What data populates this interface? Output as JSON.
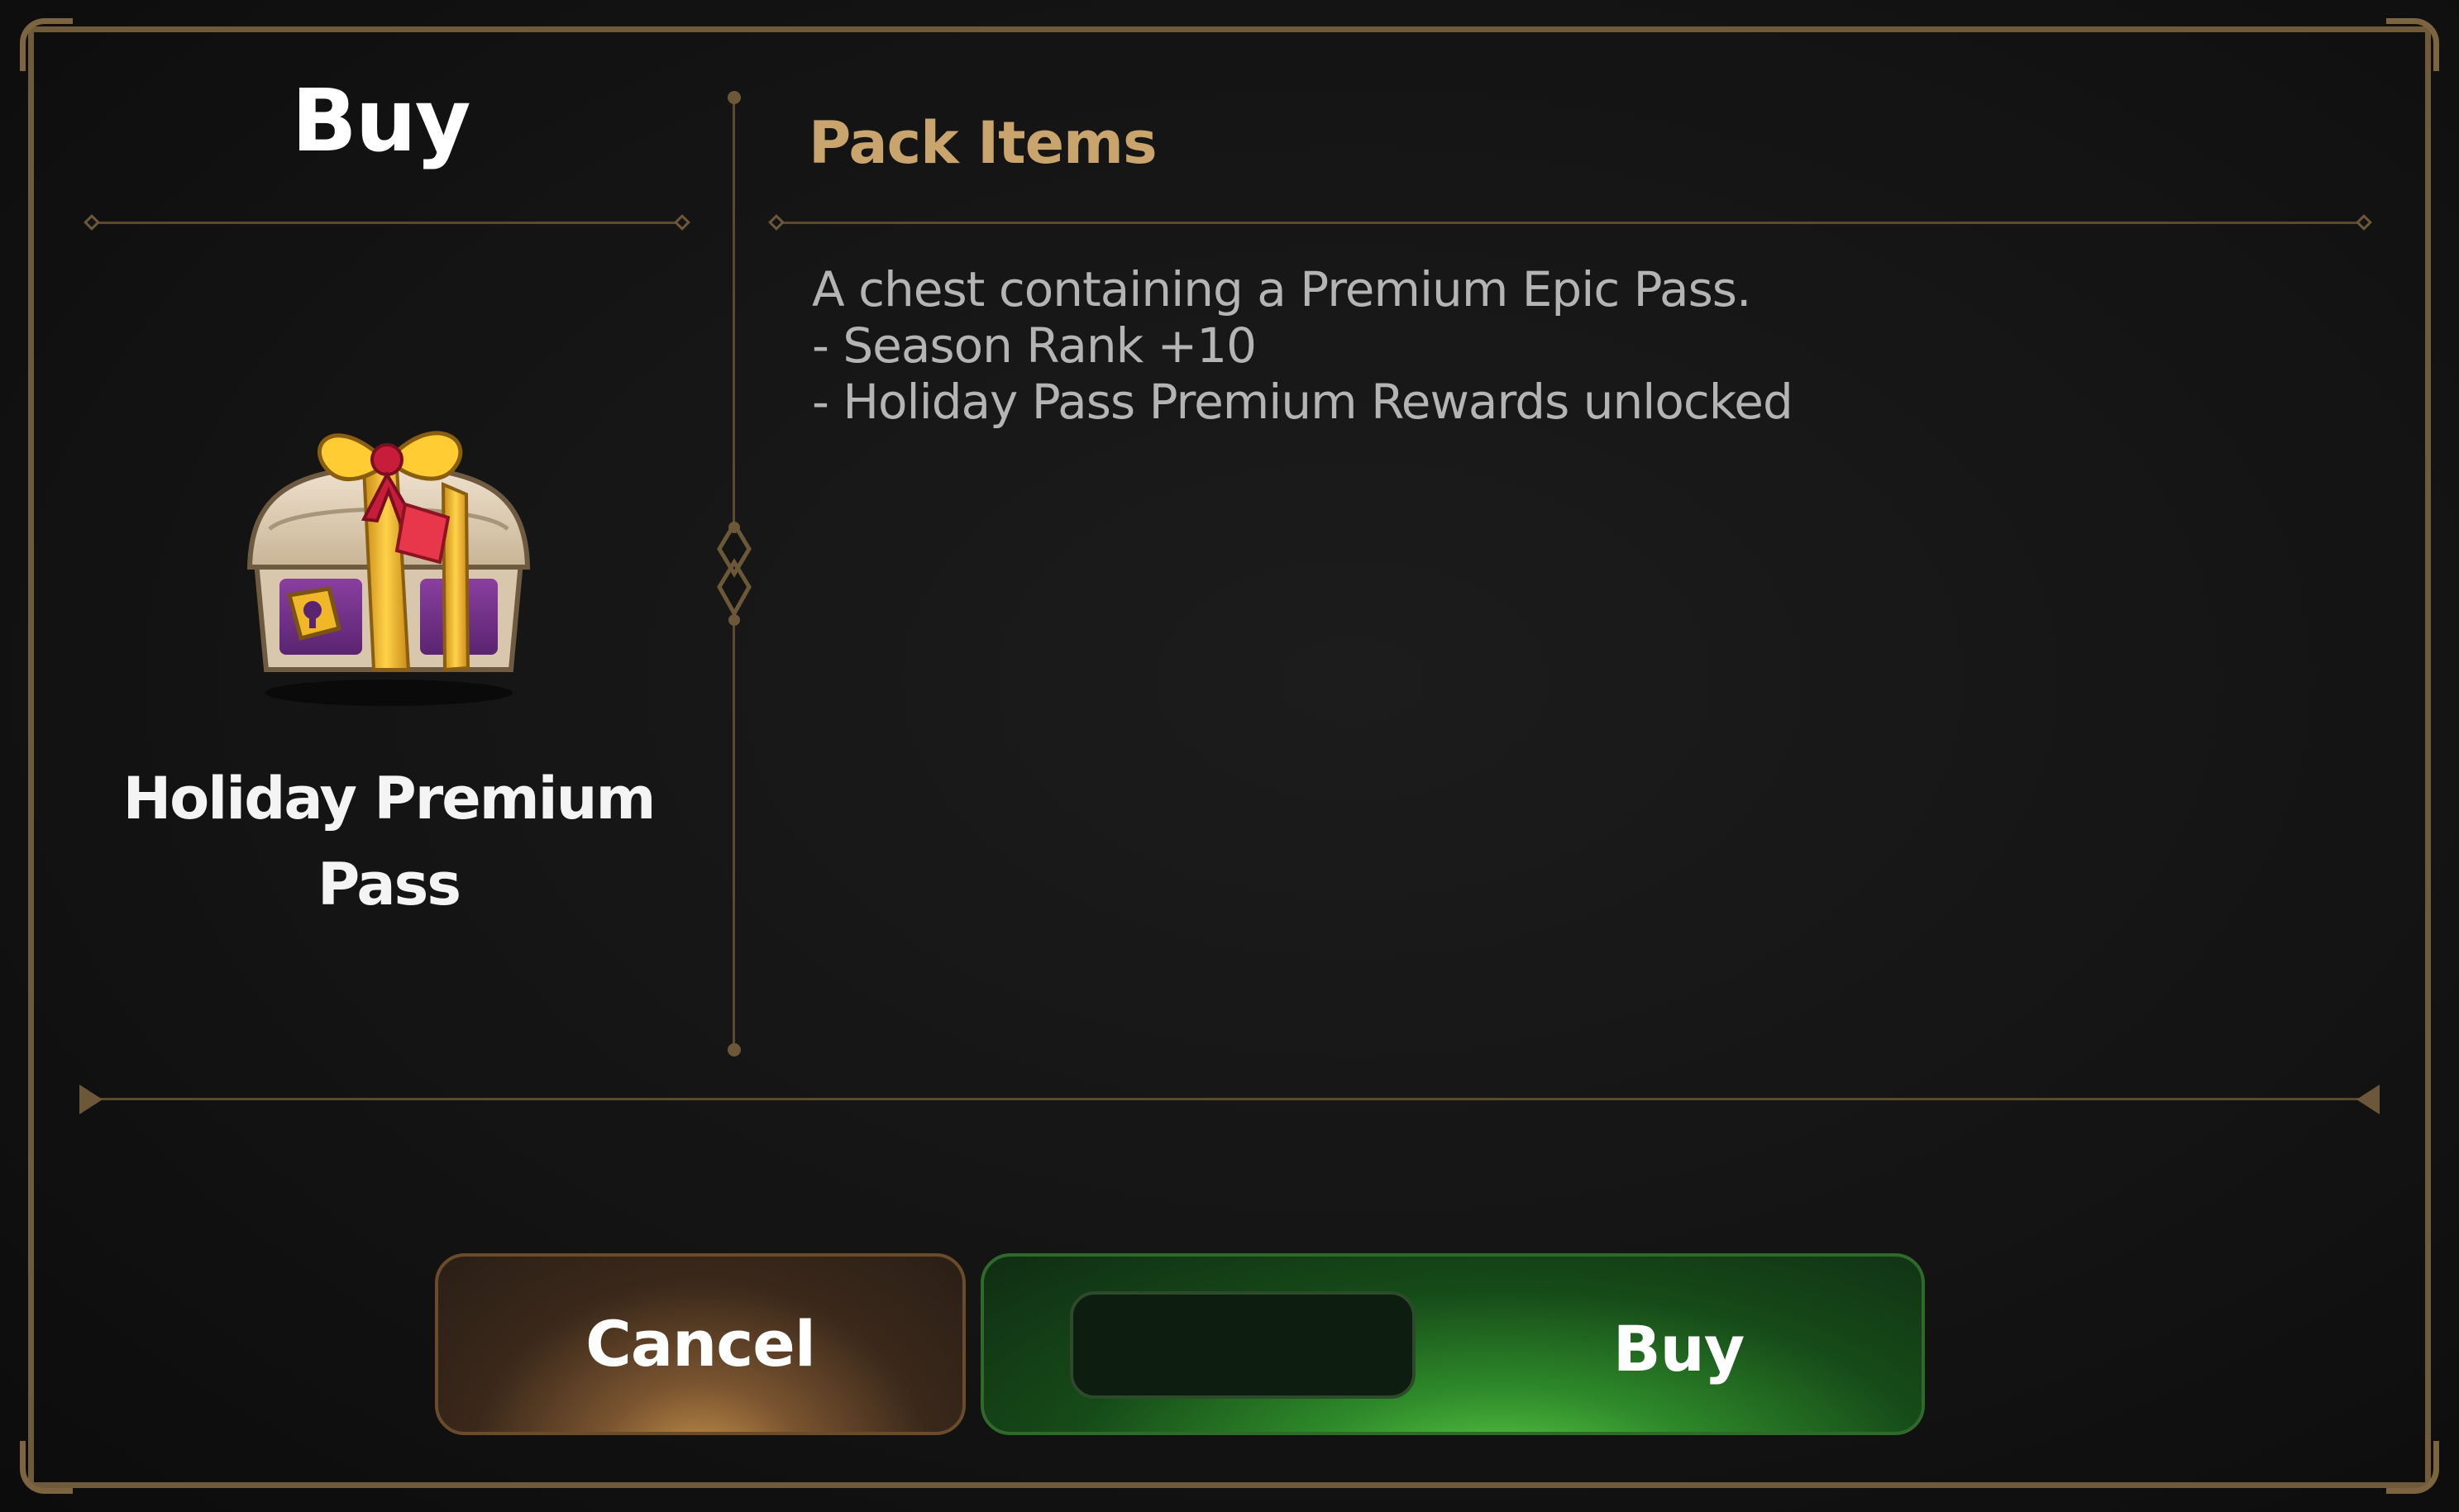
{
  "dialog": {
    "title": "Buy",
    "section_title": "Pack Items"
  },
  "item": {
    "name": "Holiday Premium Pass",
    "icon": "gift-chest-icon"
  },
  "description": {
    "intro": "A chest containing a Premium Epic Pass.",
    "bullets": [
      "- Season Rank +10",
      "- Holiday Pass Premium Rewards unlocked"
    ]
  },
  "buttons": {
    "cancel_label": "Cancel",
    "buy_label": "Buy"
  },
  "colors": {
    "accent_gold": "#c9a46c",
    "frame": "#6f5a3a",
    "buy_green": "#2e8a2a",
    "cancel_brown": "#7a5430"
  }
}
